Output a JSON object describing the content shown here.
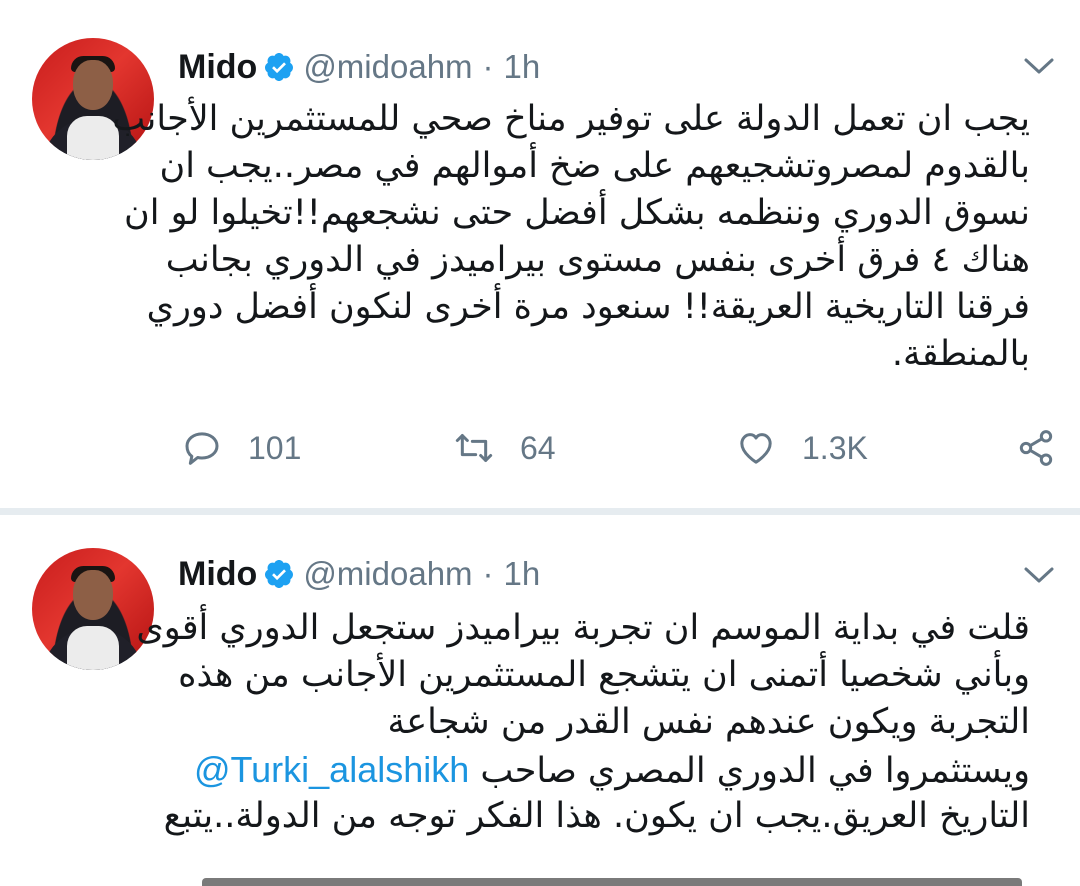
{
  "colors": {
    "text": "#14171a",
    "muted": "#657786",
    "link": "#1b95e0",
    "verified": "#1da1f2",
    "divider": "#e6ecf0"
  },
  "icons": {
    "verified": "verified-badge-icon",
    "menu": "chevron-down-icon",
    "reply": "reply-icon",
    "retweet": "retweet-icon",
    "like": "heart-icon",
    "share": "share-icon"
  },
  "tweets": [
    {
      "author": {
        "name": "Mido",
        "handle": "@midoahm",
        "separator": "·",
        "time": "1h"
      },
      "lines": [
        "يجب ان تعمل الدولة على توفير مناخ صحي للمستثمرين الأجانب",
        "بالقدوم لمصروتشجيعهم على ضخ أموالهم في مصر..يجب ان",
        "نسوق الدوري وننظمه بشكل أفضل حتى نشجعهم!!تخيلوا لو ان",
        "هناك ٤ فرق أخرى بنفس مستوى بيراميدز في الدوري بجانب",
        "فرقنا التاريخية العريقة!! سنعود مرة أخرى لنكون أفضل دوري",
        "بالمنطقة."
      ],
      "stats": {
        "replies": "101",
        "retweets": "64",
        "likes": "1.3K"
      }
    },
    {
      "author": {
        "name": "Mido",
        "handle": "@midoahm",
        "separator": "·",
        "time": "1h"
      },
      "lines": [
        "قلت في بداية الموسم ان تجربة بيراميدز ستجعل الدوري أقوى",
        "وبأني شخصيا أتمنى ان يتشجع المستثمرين الأجانب من هذه",
        "التجربة ويكون عندهم نفس القدر من شجاعة"
      ],
      "mention_line": {
        "mention": "@Turki_alalshikh",
        "text": "ويستثمروا في الدوري المصري صاحب"
      },
      "last_line": "التاريخ العريق.يجب ان يكون. هذا الفكر توجه من الدولة..يتبع"
    }
  ]
}
